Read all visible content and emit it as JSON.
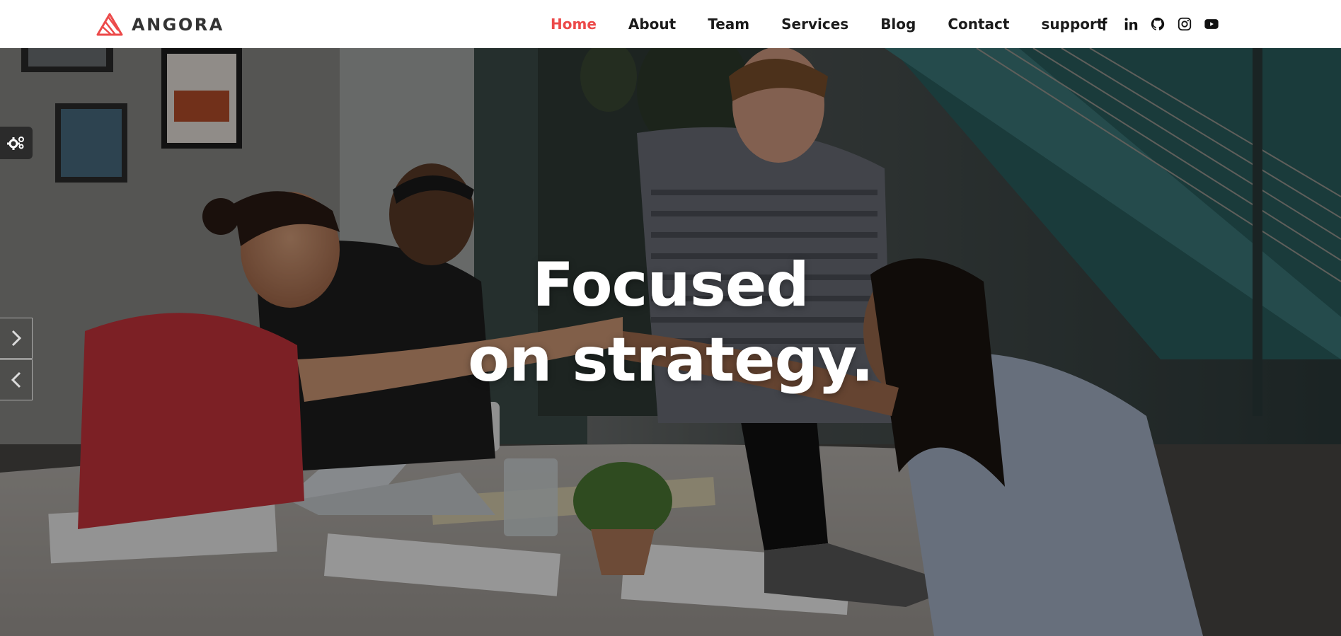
{
  "brand": {
    "name": "ANGORA",
    "accent_color": "#ec4a4a"
  },
  "nav": {
    "items": [
      {
        "label": "Home",
        "active": true
      },
      {
        "label": "About",
        "active": false
      },
      {
        "label": "Team",
        "active": false
      },
      {
        "label": "Services",
        "active": false
      },
      {
        "label": "Blog",
        "active": false
      },
      {
        "label": "Contact",
        "active": false
      },
      {
        "label": "support",
        "active": false
      }
    ]
  },
  "social": [
    "facebook-icon",
    "linkedin-icon",
    "github-icon",
    "instagram-icon",
    "youtube-icon"
  ],
  "hero": {
    "title_line1": "Focused",
    "title_line2": "on strategy."
  },
  "controls": {
    "settings_icon": "gears-icon",
    "next_icon": "chevron-right-icon",
    "prev_icon": "chevron-left-icon"
  }
}
